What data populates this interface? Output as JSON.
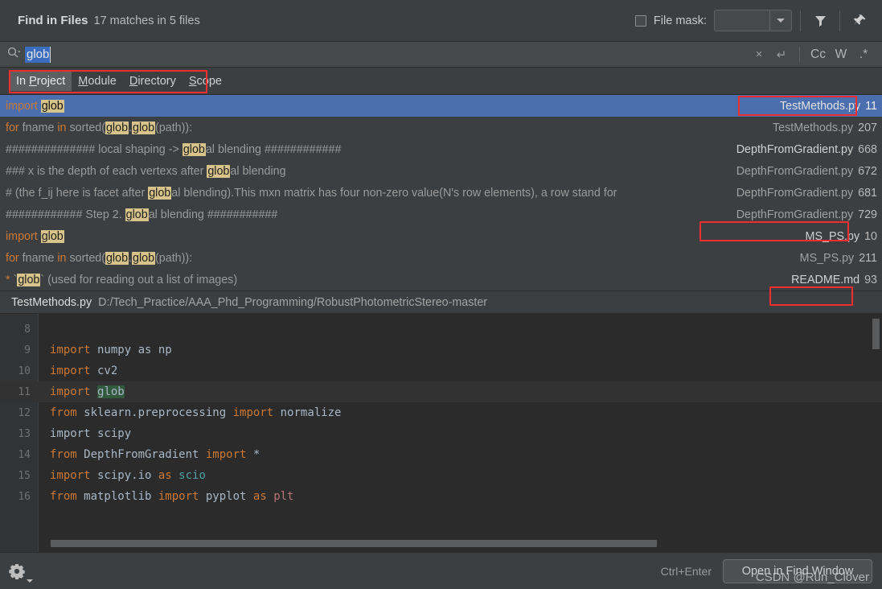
{
  "header": {
    "title": "Find in Files",
    "summary": "17 matches in 5 files",
    "file_mask_label": "File mask:",
    "file_mask_value": "",
    "filter_icon": "filter-icon",
    "pin_icon": "pin-icon"
  },
  "search": {
    "query": "glob",
    "magnifier_icon": "search-icon",
    "clear_icon": "×",
    "history_icon": "↵",
    "case_label": "Cc",
    "word_label": "W",
    "regex_label": ".*"
  },
  "scope": {
    "tabs": [
      {
        "label": "In Project",
        "mnemonic": "P",
        "active": true
      },
      {
        "label": "Module",
        "mnemonic": "M",
        "active": false
      },
      {
        "label": "Directory",
        "mnemonic": "D",
        "active": false
      },
      {
        "label": "Scope",
        "mnemonic": "S",
        "active": false
      }
    ]
  },
  "results": [
    {
      "prefix_kw": "import",
      "text_before": " ",
      "match": "glob",
      "text_after": "",
      "file": "TestMethods.py",
      "line": "11",
      "selected": true,
      "comment": false,
      "annotated": true
    },
    {
      "prefix_kw": "for",
      "text_before": " fname ",
      "kw2": "in",
      "text_mid": " sorted(",
      "match": "glob",
      "text_dot": ".",
      "match2": "glob",
      "text_after": "(path)):",
      "file": "TestMethods.py",
      "line": "207",
      "selected": false,
      "comment": false,
      "annotated": false
    },
    {
      "comment_before": "############## local shaping -> ",
      "match": "glob",
      "comment_after": "al blending ############",
      "file": "DepthFromGradient.py",
      "line": "668",
      "selected": false,
      "comment": true,
      "bright_file": true,
      "annotated": false
    },
    {
      "comment_before": "### x is the depth of each vertexs after ",
      "match": "glob",
      "comment_after": "al blending",
      "file": "DepthFromGradient.py",
      "line": "672",
      "selected": false,
      "comment": true,
      "annotated": false
    },
    {
      "comment_before": "# (the f_ij here is facet after ",
      "match": "glob",
      "comment_after": "al blending).This mxn matrix has four non-zero value(N's row elements), a row stand for",
      "file": "DepthFromGradient.py",
      "line": "681",
      "selected": false,
      "comment": true,
      "annotated": false
    },
    {
      "comment_before": "############ Step 2. ",
      "match": "glob",
      "comment_after": "al blending ###########",
      "file": "DepthFromGradient.py",
      "line": "729",
      "selected": false,
      "comment": true,
      "annotated": true
    },
    {
      "prefix_kw": "import",
      "text_before": " ",
      "match": "glob",
      "text_after": "",
      "file": "MS_PS.py",
      "line": "10",
      "selected": false,
      "comment": false,
      "bright_file": true,
      "annotated": false
    },
    {
      "prefix_kw": "for",
      "text_before": " fname ",
      "kw2": "in",
      "text_mid": " sorted(",
      "match": "glob",
      "text_dot": ".",
      "match2": "glob",
      "text_after": "(path)):",
      "file": "MS_PS.py",
      "line": "211",
      "selected": false,
      "comment": false,
      "annotated": false
    },
    {
      "star": "*",
      "text_before": " `",
      "match": "glob",
      "text_after": "` (used for reading out a list of images)",
      "file": "README.md",
      "line": "93",
      "selected": false,
      "comment": false,
      "annotated": true
    }
  ],
  "path_bar": {
    "file": "TestMethods.py",
    "directory": "D:/Tech_Practice/AAA_Phd_Programming/RobustPhotometricStereo-master"
  },
  "code_preview": [
    {
      "num": "8",
      "plain": ""
    },
    {
      "num": "9",
      "kw": "import",
      "rest": " numpy as np"
    },
    {
      "num": "10",
      "kw": "import",
      "rest": " cv2"
    },
    {
      "num": "11",
      "kw": "import",
      "rest": " ",
      "match": "glob",
      "current": true
    },
    {
      "num": "12",
      "kw": "from",
      "rest": " sklearn.preprocessing ",
      "kw2": "import",
      "rest2": " normalize"
    },
    {
      "num": "13",
      "gray": "import scipy"
    },
    {
      "num": "14",
      "kw": "from",
      "rest": " DepthFromGradient ",
      "kw2": "import",
      "rest2": " *"
    },
    {
      "num": "15",
      "kw": "import",
      "rest": " scipy.io ",
      "kw2": "as",
      "cyan": " scio"
    },
    {
      "num": "16",
      "kw": "from",
      "rest": " matplotlib ",
      "kw2": "import",
      "rest2": " pyplot ",
      "kw3": "as",
      "pink": " plt"
    }
  ],
  "footer": {
    "settings_icon": "gear-icon",
    "shortcut": "Ctrl+Enter",
    "primary_button": "Open in Find Window",
    "watermark": "CSDN @Run_Clover"
  },
  "colors": {
    "selection_blue": "#4b6eaf",
    "match_highlight": "#d8c48a",
    "keyword_orange": "#cc7832",
    "annotation_red": "#ef2f2f",
    "panel_bg": "#3c3f41",
    "editor_bg": "#2b2b2b"
  }
}
